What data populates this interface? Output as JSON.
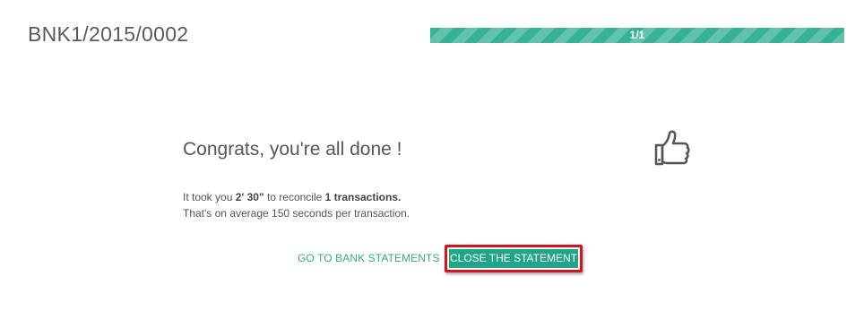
{
  "header": {
    "statement_name": "BNK1/2015/0002",
    "progress_text": "1/1",
    "progress_fraction": 1.0
  },
  "completion": {
    "title": "Congrats, you're all done !",
    "line1_prefix": "It took you ",
    "time": "2' 30\"",
    "line1_mid": " to reconcile ",
    "count_text": "1 transactions.",
    "line2": "That's on average 150 seconds per transaction.",
    "icon": "thumbs-up-icon"
  },
  "actions": {
    "go_to_bank_statements": "GO TO BANK STATEMENTS",
    "close_the_statement": "CLOSE THE STATEMENT"
  },
  "colors": {
    "accent": "#21a589",
    "progress": "#36b296",
    "highlight_border": "#d4151c"
  }
}
